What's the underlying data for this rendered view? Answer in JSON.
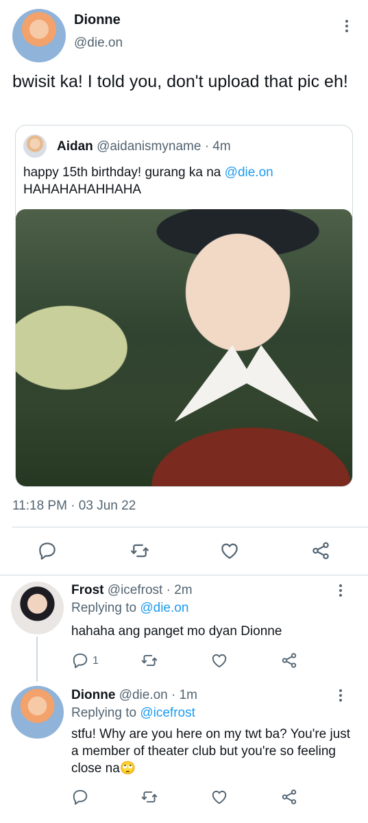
{
  "main_tweet": {
    "name": "Dionne",
    "handle": "@die.on",
    "text": "bwisit ka! I told you, don't upload that pic eh!",
    "timestamp": "11:18 PM · 03 Jun 22"
  },
  "quoted_tweet": {
    "name": "Aidan",
    "handle_time": "@aidanismyname · 4m",
    "text_prefix": "happy 15th birthday! gurang ka na ",
    "mention": "@die.on",
    "text_suffix": "HAHAHAHAHHAHA"
  },
  "replies": [
    {
      "name": "Frost",
      "handle_time": "@icefrost · 2m",
      "replying_label": "Replying to ",
      "replying_to": "@die.on",
      "text": "hahaha ang panget mo dyan Dionne",
      "reply_count": "1"
    },
    {
      "name": "Dionne",
      "handle_time": "@die.on · 1m",
      "replying_label": "Replying to ",
      "replying_to": "@icefrost",
      "text": "stfu! Why are you here on my twt ba? You're just a member of theater club but you're so feeling close na🙄",
      "reply_count": ""
    }
  ],
  "colors": {
    "accent": "#1d9bf0",
    "secondary_text": "#536471",
    "divider": "#cfd9de"
  },
  "icons": [
    "more-icon",
    "reply-icon",
    "retweet-icon",
    "like-icon",
    "share-icon"
  ]
}
